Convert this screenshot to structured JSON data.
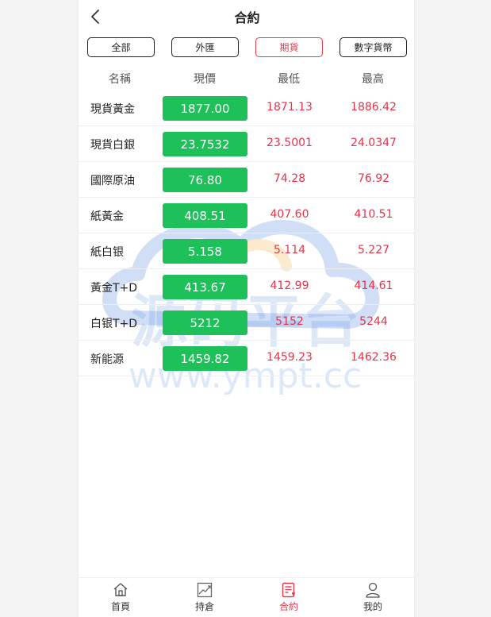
{
  "header": {
    "title": "合約",
    "back_icon": "chevron-left-icon"
  },
  "filters": [
    {
      "label": "全部",
      "active": false
    },
    {
      "label": "外匯",
      "active": false
    },
    {
      "label": "期貨",
      "active": true
    },
    {
      "label": "數字貨幣",
      "active": false
    }
  ],
  "table": {
    "columns": [
      "名稱",
      "現價",
      "最低",
      "最高"
    ],
    "rows": [
      {
        "name": "現貨黃金",
        "price": "1877.00",
        "low": "1871.13",
        "high": "1886.42"
      },
      {
        "name": "現貨白銀",
        "price": "23.7532",
        "low": "23.5001",
        "high": "24.0347"
      },
      {
        "name": "國際原油",
        "price": "76.80",
        "low": "74.28",
        "high": "76.92"
      },
      {
        "name": "紙黃金",
        "price": "408.51",
        "low": "407.60",
        "high": "410.51"
      },
      {
        "name": "紙白银",
        "price": "5.158",
        "low": "5.114",
        "high": "5.227"
      },
      {
        "name": "黃金T+D",
        "price": "413.67",
        "low": "412.99",
        "high": "414.61"
      },
      {
        "name": "白银T+D",
        "price": "5212",
        "low": "5152",
        "high": "5244"
      },
      {
        "name": "新能源",
        "price": "1459.82",
        "low": "1459.23",
        "high": "1462.36"
      }
    ]
  },
  "watermark": {
    "text": "源码平台",
    "url": "www.ympt.cc"
  },
  "bottom_nav": [
    {
      "label": "首頁",
      "icon": "home-icon",
      "active": false
    },
    {
      "label": "持倉",
      "icon": "chart-icon",
      "active": false
    },
    {
      "label": "合約",
      "icon": "contract-icon",
      "active": true
    },
    {
      "label": "我的",
      "icon": "user-icon",
      "active": false
    }
  ],
  "colors": {
    "accent_red": "#e33b4c",
    "price_green": "#1ec059",
    "value_red": "#e8334a"
  }
}
